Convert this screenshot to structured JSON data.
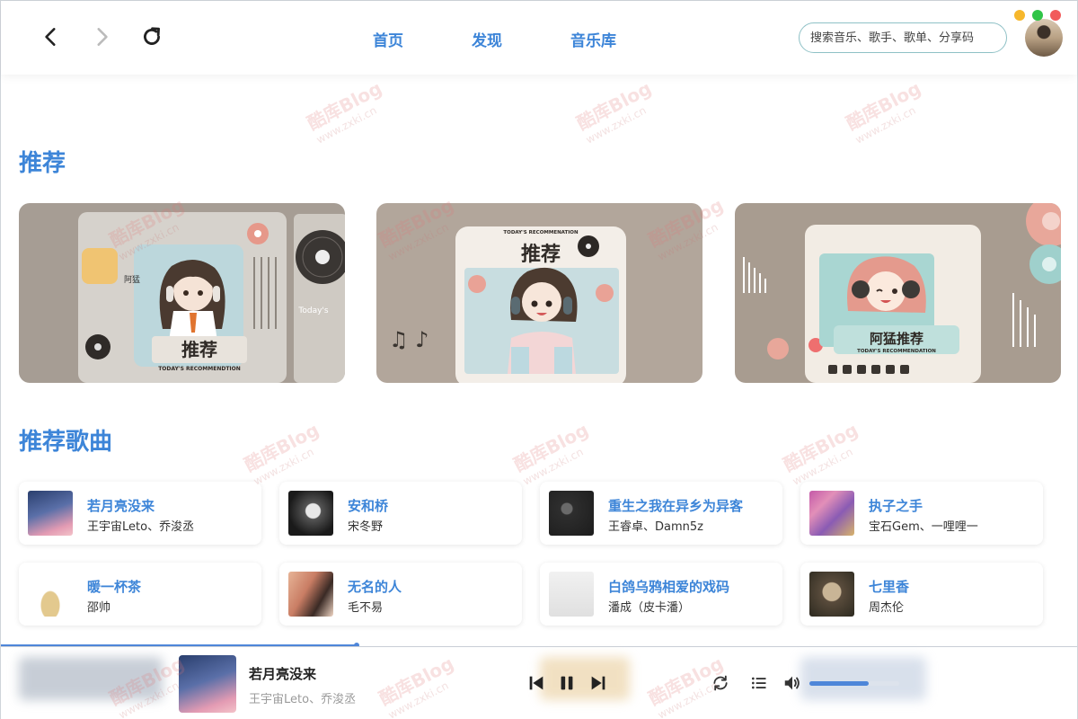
{
  "header": {
    "tabs": [
      {
        "label": "首页"
      },
      {
        "label": "发现"
      },
      {
        "label": "音乐库"
      }
    ],
    "search_placeholder": "搜索音乐、歌手、歌单、分享码",
    "window_controls": {
      "minimize": "#f6b72c",
      "maximize": "#2fc447",
      "close": "#f15b5b"
    }
  },
  "sections": {
    "recommend_title": "推荐",
    "songs_title": "推荐歌曲"
  },
  "banners": [
    {
      "title": "推荐",
      "small_text": "阿猛",
      "subtitle": "TODAY'S RECOMMENDTION",
      "side_text": "Today's"
    },
    {
      "title": "推荐",
      "small_text": "",
      "subtitle": "TODAY'S RECOMMENATION",
      "side_text": ""
    },
    {
      "title": "阿猛推荐",
      "small_text": "",
      "subtitle": "TODAY'S RECOMMENDATION",
      "side_text": ""
    }
  ],
  "songs": [
    {
      "title": "若月亮没来",
      "artist": "王宇宙Leto、乔浚丞"
    },
    {
      "title": "安和桥",
      "artist": "宋冬野"
    },
    {
      "title": "重生之我在异乡为异客",
      "artist": "王睿卓、Damn5z"
    },
    {
      "title": "执子之手",
      "artist": "宝石Gem、一哩哩一"
    },
    {
      "title": "暖一杯茶",
      "artist": "邵帅"
    },
    {
      "title": "无名的人",
      "artist": "毛不易"
    },
    {
      "title": "白鸽乌鸦相爱的戏码",
      "artist": "潘成（皮卡潘）"
    },
    {
      "title": "七里香",
      "artist": "周杰伦"
    }
  ],
  "player": {
    "title": "若月亮没来",
    "artist": "王宇宙Leto、乔浚丞",
    "progress_fraction": 0.33,
    "volume_fraction": 0.66
  },
  "accent": "#3d85d8",
  "watermark": {
    "brand": "酷库Blog",
    "url": "www.zxki.cn"
  }
}
